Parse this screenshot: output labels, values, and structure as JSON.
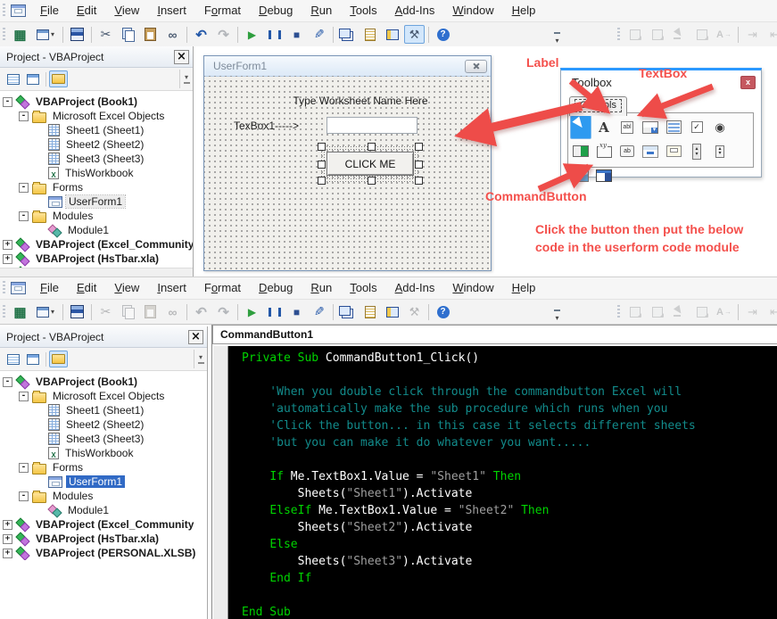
{
  "menu": {
    "items": [
      {
        "pre": "",
        "key": "F",
        "post": "ile"
      },
      {
        "pre": "",
        "key": "E",
        "post": "dit"
      },
      {
        "pre": "",
        "key": "V",
        "post": "iew"
      },
      {
        "pre": "",
        "key": "I",
        "post": "nsert"
      },
      {
        "pre": "F",
        "key": "o",
        "post": "rmat"
      },
      {
        "pre": "",
        "key": "D",
        "post": "ebug"
      },
      {
        "pre": "",
        "key": "R",
        "post": "un"
      },
      {
        "pre": "",
        "key": "T",
        "post": "ools"
      },
      {
        "pre": "",
        "key": "A",
        "post": "dd-Ins"
      },
      {
        "pre": "",
        "key": "W",
        "post": "indow"
      },
      {
        "pre": "",
        "key": "H",
        "post": "elp"
      }
    ]
  },
  "toolbars": {
    "standard_top": [
      {
        "name": "view-microsoft-excel-button",
        "cls": "tb-excel"
      },
      {
        "name": "insert-userform-button",
        "cls": "tb-insertform"
      },
      {
        "name": "toolbar-separator",
        "cls": "tbsep",
        "inter": false
      },
      {
        "name": "save-button",
        "cls": "tb-save"
      },
      {
        "name": "toolbar-separator",
        "cls": "tbsep",
        "inter": false
      },
      {
        "name": "cut-button",
        "cls": "tb-cut"
      },
      {
        "name": "copy-button",
        "cls": "tb-copy"
      },
      {
        "name": "paste-button",
        "cls": "tb-paste"
      },
      {
        "name": "find-button",
        "cls": "tb-find"
      },
      {
        "name": "toolbar-separator",
        "cls": "tbsep",
        "inter": false
      },
      {
        "name": "undo-button",
        "cls": "tb-undo"
      },
      {
        "name": "redo-button",
        "cls": "tb-redo dis"
      },
      {
        "name": "toolbar-separator",
        "cls": "tbsep",
        "inter": false
      },
      {
        "name": "run-sub-button",
        "cls": "tb-run"
      },
      {
        "name": "break-button",
        "cls": "tb-break"
      },
      {
        "name": "reset-button",
        "cls": "tb-reset"
      },
      {
        "name": "design-mode-button",
        "cls": "tb-design"
      },
      {
        "name": "toolbar-separator",
        "cls": "tbsep",
        "inter": false
      },
      {
        "name": "project-explorer-button",
        "cls": "tb-projexp"
      },
      {
        "name": "properties-window-button",
        "cls": "tb-props"
      },
      {
        "name": "object-browser-button",
        "cls": "tb-objbrowser"
      },
      {
        "name": "toolbox-button",
        "cls": "tb-toolbox act"
      },
      {
        "name": "toolbar-separator",
        "cls": "tbsep",
        "inter": false
      },
      {
        "name": "help-button",
        "cls": "tb-help"
      }
    ],
    "standard_bottom": [
      {
        "name": "view-microsoft-excel-button",
        "cls": "tb-excel"
      },
      {
        "name": "insert-userform-button",
        "cls": "tb-insertform"
      },
      {
        "name": "toolbar-separator",
        "cls": "tbsep",
        "inter": false
      },
      {
        "name": "save-button",
        "cls": "tb-save"
      },
      {
        "name": "toolbar-separator",
        "cls": "tbsep",
        "inter": false
      },
      {
        "name": "cut-button",
        "cls": "tb-cut dis"
      },
      {
        "name": "copy-button",
        "cls": "tb-copy dis"
      },
      {
        "name": "paste-button",
        "cls": "tb-paste dis"
      },
      {
        "name": "find-button",
        "cls": "tb-find dis"
      },
      {
        "name": "toolbar-separator",
        "cls": "tbsep",
        "inter": false
      },
      {
        "name": "undo-button",
        "cls": "tb-undo dis"
      },
      {
        "name": "redo-button",
        "cls": "tb-redo dis"
      },
      {
        "name": "toolbar-separator",
        "cls": "tbsep",
        "inter": false
      },
      {
        "name": "run-sub-button",
        "cls": "tb-run"
      },
      {
        "name": "break-button",
        "cls": "tb-break"
      },
      {
        "name": "reset-button",
        "cls": "tb-reset"
      },
      {
        "name": "design-mode-button",
        "cls": "tb-design"
      },
      {
        "name": "toolbar-separator",
        "cls": "tbsep",
        "inter": false
      },
      {
        "name": "project-explorer-button",
        "cls": "tb-projexp"
      },
      {
        "name": "properties-window-button",
        "cls": "tb-props"
      },
      {
        "name": "object-browser-button",
        "cls": "tb-objbrowser"
      },
      {
        "name": "toolbox-button",
        "cls": "tb-toolbox dis"
      },
      {
        "name": "toolbar-separator",
        "cls": "tbsep",
        "inter": false
      },
      {
        "name": "help-button",
        "cls": "tb-help"
      }
    ],
    "secondary": [
      {
        "name": "bring-to-front-button",
        "cls": "tb-gpage dis"
      },
      {
        "name": "send-to-back-button",
        "cls": "tb-gpage dis"
      },
      {
        "name": "select-objects-button",
        "cls": "tb-gcursor dis"
      },
      {
        "name": "group-objects-button",
        "cls": "tb-gpage dis"
      },
      {
        "name": "font-button",
        "cls": "tb-gfont dis"
      },
      {
        "name": "toolbar-separator",
        "cls": "tbsep",
        "inter": false
      },
      {
        "name": "increase-indent-button",
        "cls": "tb-gindent dis"
      },
      {
        "name": "decrease-indent-button",
        "cls": "tb-goutdent dis"
      },
      {
        "name": "toolbar-separator",
        "cls": "tbsep",
        "inter": false
      },
      {
        "name": "comment-block-button",
        "cls": "tb-gpage dis"
      }
    ]
  },
  "project": {
    "title": "Project - VBAProject",
    "tree_top": [
      {
        "label": "VBAProject (Book1)",
        "cls": "lvl0 bold",
        "icon": "ic-vba",
        "exp": "minus"
      },
      {
        "label": "Microsoft Excel Objects",
        "cls": "lvl1",
        "icon": "ic-folder",
        "exp": "minus"
      },
      {
        "label": "Sheet1 (Sheet1)",
        "cls": "lvl2",
        "icon": "ic-sheet",
        "exp": "leaf"
      },
      {
        "label": "Sheet2 (Sheet2)",
        "cls": "lvl2",
        "icon": "ic-sheet",
        "exp": "leaf"
      },
      {
        "label": "Sheet3 (Sheet3)",
        "cls": "lvl2",
        "icon": "ic-sheet",
        "exp": "leaf"
      },
      {
        "label": "ThisWorkbook",
        "cls": "lvl2",
        "icon": "ic-wb",
        "exp": "leaf"
      },
      {
        "label": "Forms",
        "cls": "lvl1",
        "icon": "ic-folder",
        "exp": "minus"
      },
      {
        "label": "UserForm1",
        "cls": "lvl2 hl",
        "icon": "ic-form",
        "exp": "leaf"
      },
      {
        "label": "Modules",
        "cls": "lvl1",
        "icon": "ic-folder",
        "exp": "minus"
      },
      {
        "label": "Module1",
        "cls": "lvl2",
        "icon": "ic-module",
        "exp": "leaf"
      },
      {
        "label": "VBAProject (Excel_Community",
        "cls": "lvl0 bold",
        "icon": "ic-vba",
        "exp": "plus"
      },
      {
        "label": "VBAProject (HsTbar.xla)",
        "cls": "lvl0 bold",
        "icon": "ic-vba",
        "exp": "plus"
      },
      {
        "label": "VBAProject (PERSONAL.XLSB)",
        "cls": "lvl0 bold",
        "icon": "ic-vba",
        "exp": "plus"
      }
    ],
    "tree_bottom": [
      {
        "label": "VBAProject (Book1)",
        "cls": "lvl0 bold",
        "icon": "ic-vba",
        "exp": "minus"
      },
      {
        "label": "Microsoft Excel Objects",
        "cls": "lvl1",
        "icon": "ic-folder",
        "exp": "minus"
      },
      {
        "label": "Sheet1 (Sheet1)",
        "cls": "lvl2",
        "icon": "ic-sheet",
        "exp": "leaf"
      },
      {
        "label": "Sheet2 (Sheet2)",
        "cls": "lvl2",
        "icon": "ic-sheet",
        "exp": "leaf"
      },
      {
        "label": "Sheet3 (Sheet3)",
        "cls": "lvl2",
        "icon": "ic-sheet",
        "exp": "leaf"
      },
      {
        "label": "ThisWorkbook",
        "cls": "lvl2",
        "icon": "ic-wb",
        "exp": "leaf"
      },
      {
        "label": "Forms",
        "cls": "lvl1",
        "icon": "ic-folder",
        "exp": "minus"
      },
      {
        "label": "UserForm1",
        "cls": "lvl2 selected",
        "icon": "ic-form",
        "exp": "leaf"
      },
      {
        "label": "Modules",
        "cls": "lvl1",
        "icon": "ic-folder",
        "exp": "minus"
      },
      {
        "label": "Module1",
        "cls": "lvl2",
        "icon": "ic-module",
        "exp": "leaf"
      },
      {
        "label": "VBAProject (Excel_Community",
        "cls": "lvl0 bold",
        "icon": "ic-vba",
        "exp": "plus"
      },
      {
        "label": "VBAProject (HsTbar.xla)",
        "cls": "lvl0 bold",
        "icon": "ic-vba",
        "exp": "plus"
      },
      {
        "label": "VBAProject (PERSONAL.XLSB)",
        "cls": "lvl0 bold",
        "icon": "ic-vba",
        "exp": "plus"
      }
    ]
  },
  "userform": {
    "title": "UserForm1",
    "header_label": "Type Worksheet Name Here",
    "textbox_caption": "TexBox1----->",
    "textbox_value": "",
    "button_label": "CLICK ME"
  },
  "toolbox": {
    "title": "Toolbox",
    "close_label": "x",
    "tab_label": "Controls",
    "controls": [
      {
        "name": "toolbox-select-objects",
        "cls": "tx-select sel"
      },
      {
        "name": "toolbox-label",
        "cls": "tx-label"
      },
      {
        "name": "toolbox-textbox",
        "cls": "tx-textbox"
      },
      {
        "name": "toolbox-combobox",
        "cls": "tx-combo"
      },
      {
        "name": "toolbox-listbox",
        "cls": "tx-list"
      },
      {
        "name": "toolbox-checkbox",
        "cls": "tx-check"
      },
      {
        "name": "toolbox-optionbutton",
        "cls": "tx-option"
      },
      {
        "name": "toolbox-togglebutton",
        "cls": "tx-toggle"
      },
      {
        "name": "toolbox-frame",
        "cls": "tx-frame"
      },
      {
        "name": "toolbox-commandbutton",
        "cls": "tx-command"
      },
      {
        "name": "toolbox-tabstrip",
        "cls": "tx-tabstrip"
      },
      {
        "name": "toolbox-multipage",
        "cls": "tx-multipage"
      },
      {
        "name": "toolbox-scrollbar",
        "cls": "tx-scrollbar"
      },
      {
        "name": "toolbox-spinbutton",
        "cls": "tx-spin"
      },
      {
        "name": "toolbox-image",
        "cls": "tx-image"
      },
      {
        "name": "toolbox-refedit",
        "cls": "tx-refedit"
      }
    ]
  },
  "annotations": {
    "label": "Label",
    "textbox": "TextBox",
    "commandbutton": "CommandButton",
    "instruction1": "Click the button then put the below",
    "instruction2": "code in the userform code module",
    "color": "#f4504c"
  },
  "code": {
    "object_dropdown": "CommandButton1",
    "lines": [
      {
        "tokens": [
          {
            "t": "Private Sub ",
            "c": "kw"
          },
          {
            "t": "CommandButton1_Click()",
            "c": "pln"
          }
        ]
      },
      {
        "tokens": []
      },
      {
        "tokens": [
          {
            "t": "    'When you double click through the commandbutton Excel will",
            "c": "com"
          }
        ]
      },
      {
        "tokens": [
          {
            "t": "    'automatically make the sub procedure which runs when you",
            "c": "com"
          }
        ]
      },
      {
        "tokens": [
          {
            "t": "    'Click the button... in this case it selects different sheets",
            "c": "com"
          }
        ]
      },
      {
        "tokens": [
          {
            "t": "    'but you can make it do whatever you want.....",
            "c": "com"
          }
        ]
      },
      {
        "tokens": []
      },
      {
        "tokens": [
          {
            "t": "    ",
            "c": "pln"
          },
          {
            "t": "If ",
            "c": "kw"
          },
          {
            "t": "Me.TextBox1.Value = ",
            "c": "pln"
          },
          {
            "t": "\"Sheet1\"",
            "c": "str"
          },
          {
            "t": " ",
            "c": "pln"
          },
          {
            "t": "Then",
            "c": "kw"
          }
        ]
      },
      {
        "tokens": [
          {
            "t": "        Sheets(",
            "c": "pln"
          },
          {
            "t": "\"Sheet1\"",
            "c": "str"
          },
          {
            "t": ").Activate",
            "c": "pln"
          }
        ]
      },
      {
        "tokens": [
          {
            "t": "    ",
            "c": "pln"
          },
          {
            "t": "ElseIf ",
            "c": "kw"
          },
          {
            "t": "Me.TextBox1.Value = ",
            "c": "pln"
          },
          {
            "t": "\"Sheet2\"",
            "c": "str"
          },
          {
            "t": " ",
            "c": "pln"
          },
          {
            "t": "Then",
            "c": "kw"
          }
        ]
      },
      {
        "tokens": [
          {
            "t": "        Sheets(",
            "c": "pln"
          },
          {
            "t": "\"Sheet2\"",
            "c": "str"
          },
          {
            "t": ").Activate",
            "c": "pln"
          }
        ]
      },
      {
        "tokens": [
          {
            "t": "    ",
            "c": "pln"
          },
          {
            "t": "Else",
            "c": "kw"
          }
        ]
      },
      {
        "tokens": [
          {
            "t": "        Sheets(",
            "c": "pln"
          },
          {
            "t": "\"Sheet3\"",
            "c": "str"
          },
          {
            "t": ").Activate",
            "c": "pln"
          }
        ]
      },
      {
        "tokens": [
          {
            "t": "    ",
            "c": "pln"
          },
          {
            "t": "End If",
            "c": "kw"
          }
        ]
      },
      {
        "tokens": []
      },
      {
        "tokens": [
          {
            "t": "End Sub",
            "c": "kw"
          }
        ]
      }
    ]
  },
  "colors": {
    "annotation_red": "#f4504c",
    "keyword_green": "#00d400",
    "comment_teal": "#128b8b",
    "string_gray": "#9f9f9f",
    "code_background": "#000000",
    "selection_blue": "#316ac5",
    "toolbox_accent_blue": "#2b99ff",
    "toolbox_close_red": "#c5585f"
  }
}
